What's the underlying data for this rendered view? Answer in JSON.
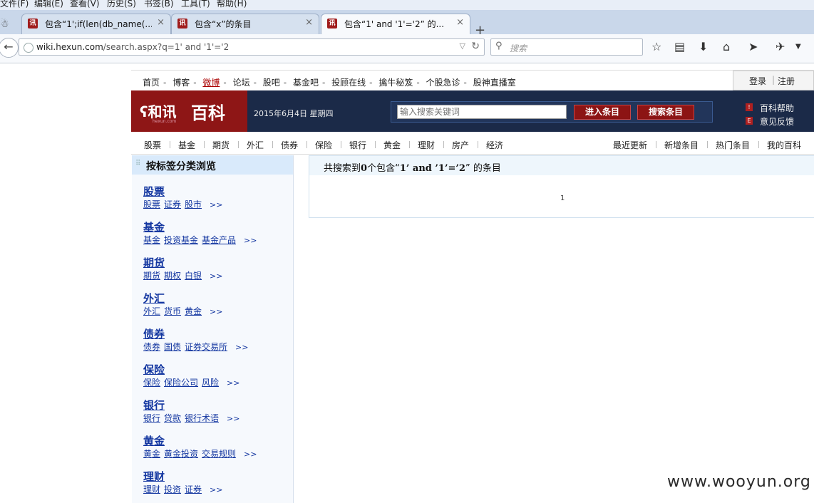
{
  "menu": [
    "文件(F)",
    "编辑(E)",
    "查看(V)",
    "历史(S)",
    "书签(B)",
    "工具(T)",
    "帮助(H)"
  ],
  "tabs": [
    {
      "favicon": "hexun-favicon",
      "label": "包含“1';if(len(db_name(...",
      "close": "×"
    },
    {
      "favicon": "hexun-favicon",
      "label": "包含“x”的条目",
      "close": "×"
    },
    {
      "favicon": "hexun-favicon",
      "label": "包含“1' and '1'='2” 的...",
      "close": "×"
    }
  ],
  "new_tab_label": "+",
  "address": {
    "host": "wiki.hexun.com",
    "path": "/search.aspx?q=1' and '1'='2"
  },
  "browser_search_placeholder": "搜索",
  "topnav": {
    "links": [
      "首页",
      "博客",
      "微博",
      "论坛",
      "股吧",
      "基金吧",
      "投顾在线",
      "擒牛秘笈",
      "个股急诊",
      "股神直播室"
    ],
    "separator": "-",
    "login": "登录",
    "register": "注册",
    "login_sep": "|"
  },
  "banner": {
    "logo_brand": "和讯",
    "logo_sub": "hexun.com",
    "logo_title": "百科",
    "date": "2015年6月4日  星期四",
    "search_placeholder": "输入搜索关键词",
    "enter_button": "进入条目",
    "search_button": "搜索条目",
    "help": "百科帮助",
    "feedback": "意见反馈",
    "colors": {
      "banner_bg": "#1b2a48",
      "logo_bg": "#8e1616",
      "button_bg": "#8c1414"
    }
  },
  "catnav": {
    "left": [
      "股票",
      "基金",
      "期货",
      "外汇",
      "债券",
      "保险",
      "银行",
      "黄金",
      "理财",
      "房产",
      "经济"
    ],
    "right": [
      "最近更新",
      "新增条目",
      "热门条目",
      "我的百科"
    ]
  },
  "sidebar": {
    "title": "按标签分类浏览",
    "more": ">>",
    "categories": [
      {
        "title": "股票",
        "subs": [
          "股票",
          "证券",
          "股市"
        ]
      },
      {
        "title": "基金",
        "subs": [
          "基金",
          "投资基金",
          "基金产品"
        ]
      },
      {
        "title": "期货",
        "subs": [
          "期货",
          "期权",
          "白银"
        ]
      },
      {
        "title": "外汇",
        "subs": [
          "外汇",
          "货币",
          "黄金"
        ]
      },
      {
        "title": "债券",
        "subs": [
          "债券",
          "国债",
          "证券交易所"
        ]
      },
      {
        "title": "保险",
        "subs": [
          "保险",
          "保险公司",
          "风险"
        ]
      },
      {
        "title": "银行",
        "subs": [
          "银行",
          "贷款",
          "银行术语"
        ]
      },
      {
        "title": "黄金",
        "subs": [
          "黄金",
          "黄金投资",
          "交易规则"
        ]
      },
      {
        "title": "理财",
        "subs": [
          "理财",
          "投资",
          "证券"
        ]
      }
    ]
  },
  "results": {
    "prefix": "共搜索到",
    "count": "0",
    "middle": "个包含“",
    "query": "1’ and ’1’=’2",
    "suffix": "” 的条目",
    "page": "1"
  },
  "watermark": "www.wooyun.org"
}
